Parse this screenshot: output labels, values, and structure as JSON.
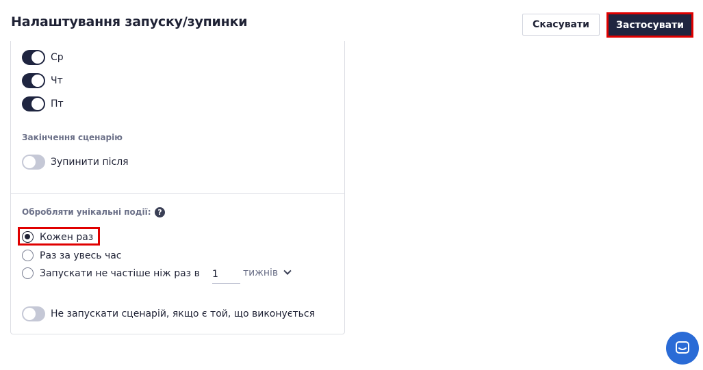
{
  "header": {
    "title": "Налаштування запуску/зупинки",
    "cancel_label": "Скасувати",
    "apply_label": "Застосувати"
  },
  "days": [
    {
      "label": "Ср",
      "enabled": true
    },
    {
      "label": "Чт",
      "enabled": true
    },
    {
      "label": "Пт",
      "enabled": true
    }
  ],
  "scenario_end": {
    "section_label": "Закінчення сценарію",
    "stop_after_label": "Зупинити після",
    "stop_after_enabled": false
  },
  "unique_events": {
    "section_label": "Обробляти унікальні події:",
    "help_icon": "question-circle-icon",
    "options": [
      {
        "label": "Кожен раз",
        "checked": true
      },
      {
        "label": "Раз за увесь час",
        "checked": false
      },
      {
        "label": "Запускати не частіше ніж раз в",
        "checked": false
      }
    ],
    "interval_value": "1",
    "interval_unit": "тижнів"
  },
  "no_parallel": {
    "label": "Не запускати сценарій, якщо є той, що виконується",
    "enabled": false
  },
  "colors": {
    "primary": "#1f2540",
    "highlight": "#e00000",
    "chat": "#2a6bd6"
  }
}
